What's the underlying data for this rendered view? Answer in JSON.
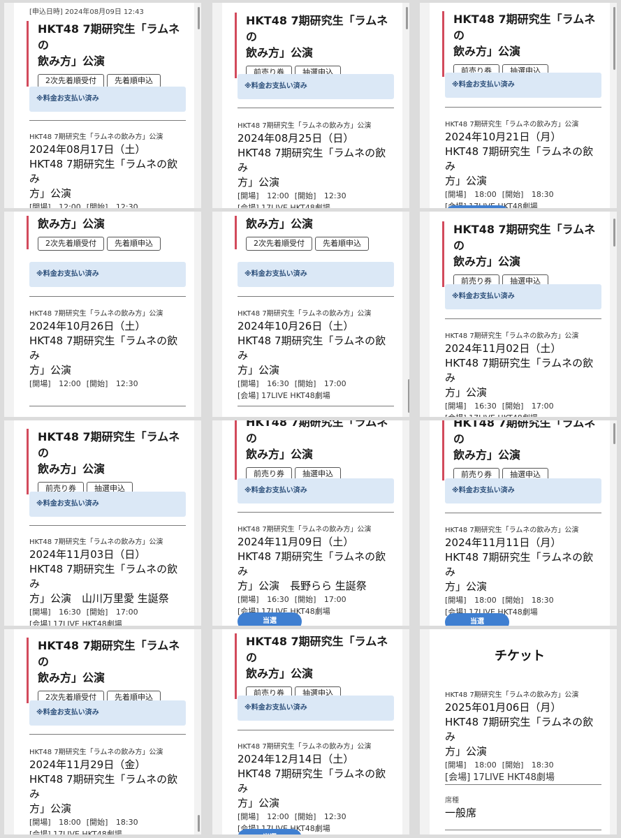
{
  "show_title": "HKT48 7期研究生「ラムネの飲み方」公演",
  "paid_notice": "※料金お支払い済み",
  "venue": "[会場] 17LIVE HKT48劇場",
  "open_label": "[開場]",
  "start_label": "[開始]",
  "win_label": "当選",
  "apply_stamp": "[申込日時] 2024年08月09日 12:43",
  "title_lines": {
    "full_a": "HKT48 7期研究生「ラムネの",
    "full_b": "飲み方」公演",
    "cut_top": "HKT48 7期研究生「ラムネの"
  },
  "buttons": {
    "second_first_come": "2次先着順受付",
    "first_come_apply": "先着順申込",
    "presale": "前売り券",
    "lottery_apply": "抽選申込"
  },
  "name_lines": {
    "a": "HKT48 7期研究生「ラムネの飲み",
    "b": "方」公演"
  },
  "events": [
    {
      "date": "2024年08月17日（土）",
      "name_b": "方」公演",
      "open": "12:00",
      "start": "12:30"
    },
    {
      "date": "2024年08月25日（日）",
      "name_b": "方」公演",
      "open": "12:00",
      "start": "12:30"
    },
    {
      "date": "2024年10月21日（月）",
      "name_b": "方」公演",
      "open": "18:00",
      "start": "18:30"
    },
    {
      "date": "2024年10月26日（土）",
      "name_b": "方」公演",
      "open": "12:00",
      "start": "12:30"
    },
    {
      "date": "2024年10月26日（土）",
      "name_b": "方」公演",
      "open": "16:30",
      "start": "17:00"
    },
    {
      "date": "2024年11月02日（土）",
      "name_b": "方」公演",
      "open": "16:30",
      "start": "17:00"
    },
    {
      "date": "2024年11月03日（日）",
      "name_b": "方」公演　山川万里愛 生誕祭",
      "open": "16:30",
      "start": "17:00"
    },
    {
      "date": "2024年11月09日（土）",
      "name_b": "方」公演　長野らら 生誕祭",
      "open": "16:30",
      "start": "17:00"
    },
    {
      "date": "2024年11月11日（月）",
      "name_b": "方」公演",
      "open": "18:00",
      "start": "18:30"
    },
    {
      "date": "2024年11月29日（金）",
      "name_b": "方」公演",
      "open": "18:00",
      "start": "18:30"
    },
    {
      "date": "2024年12月14日（土）",
      "name_b": "方」公演",
      "open": "12:00",
      "start": "12:30"
    },
    {
      "date": "2025年01月06日（月）",
      "name_b": "方」公演",
      "open": "18:00",
      "start": "18:30"
    }
  ],
  "ticket": {
    "heading": "チケット",
    "venue_bracket": "[会場] 17LIVE HKT48劇場",
    "seat_label": "席種",
    "seat_value": "一般席"
  }
}
